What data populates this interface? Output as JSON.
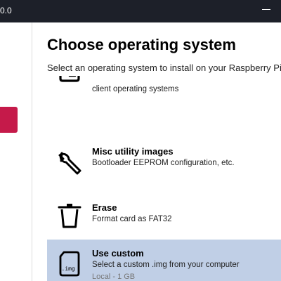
{
  "window": {
    "title": "0.0"
  },
  "dialog": {
    "title": "Choose operating system",
    "subtitle": "Select an operating system to install on your Raspberry Pi"
  },
  "os_items": [
    {
      "name": "",
      "description": "client operating systems",
      "meta": "",
      "icon": "drive-icon",
      "selected": false
    },
    {
      "name": "Misc utility images",
      "description": "Bootloader EEPROM configuration, etc.",
      "meta": "",
      "icon": "wrench-icon",
      "selected": false
    },
    {
      "name": "Erase",
      "description": "Format card as FAT32",
      "meta": "",
      "icon": "trash-icon",
      "selected": false
    },
    {
      "name": "Use custom",
      "description": "Select a custom .img from your computer",
      "meta": "Local - 1 GB",
      "icon": "img-file-icon",
      "selected": true
    }
  ],
  "icons": {
    "img_label": ".img"
  },
  "colors": {
    "titlebar": "#1d2029",
    "accent_red": "#c51a4a",
    "selected_row": "#c0cfe6"
  }
}
